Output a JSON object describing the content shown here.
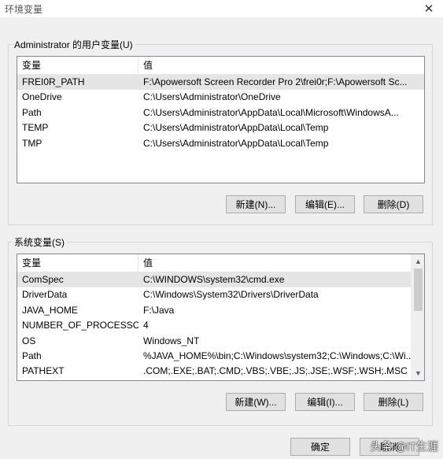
{
  "window": {
    "title": "环境变量",
    "close_glyph": "✕"
  },
  "user_vars": {
    "group_label": "Administrator 的用户变量(U)",
    "col_name": "变量",
    "col_value": "值",
    "rows": [
      {
        "name": "FREI0R_PATH",
        "value": "F:\\Apowersoft Screen Recorder Pro 2\\frei0r;F:\\Apowersoft Sc...",
        "selected": true
      },
      {
        "name": "OneDrive",
        "value": "C:\\Users\\Administrator\\OneDrive",
        "selected": false
      },
      {
        "name": "Path",
        "value": "C:\\Users\\Administrator\\AppData\\Local\\Microsoft\\WindowsA...",
        "selected": false
      },
      {
        "name": "TEMP",
        "value": "C:\\Users\\Administrator\\AppData\\Local\\Temp",
        "selected": false
      },
      {
        "name": "TMP",
        "value": "C:\\Users\\Administrator\\AppData\\Local\\Temp",
        "selected": false
      }
    ],
    "buttons": {
      "new": "新建(N)...",
      "edit": "编辑(E)...",
      "delete": "删除(D)"
    }
  },
  "system_vars": {
    "group_label": "系统变量(S)",
    "col_name": "变量",
    "col_value": "值",
    "rows": [
      {
        "name": "ComSpec",
        "value": "C:\\WINDOWS\\system32\\cmd.exe",
        "selected": true
      },
      {
        "name": "DriverData",
        "value": "C:\\Windows\\System32\\Drivers\\DriverData",
        "selected": false
      },
      {
        "name": "JAVA_HOME",
        "value": "F:\\Java",
        "selected": false
      },
      {
        "name": "NUMBER_OF_PROCESSORS",
        "value": "4",
        "selected": false
      },
      {
        "name": "OS",
        "value": "Windows_NT",
        "selected": false
      },
      {
        "name": "Path",
        "value": "%JAVA_HOME%\\bin;C:\\Windows\\system32;C:\\Windows;C:\\Wi...",
        "selected": false
      },
      {
        "name": "PATHEXT",
        "value": ".COM;.EXE;.BAT;.CMD;.VBS;.VBE;.JS;.JSE;.WSF;.WSH;.MSC",
        "selected": false
      }
    ],
    "buttons": {
      "new": "新建(W)...",
      "edit": "编辑(I)...",
      "delete": "删除(L)"
    }
  },
  "footer": {
    "ok": "确定",
    "cancel": "取消"
  },
  "watermark": "头条 @IT生涯",
  "icons": {
    "scroll_up": "scroll-up-arrow-icon",
    "scroll_down": "scroll-down-arrow-icon",
    "close": "close-icon"
  }
}
